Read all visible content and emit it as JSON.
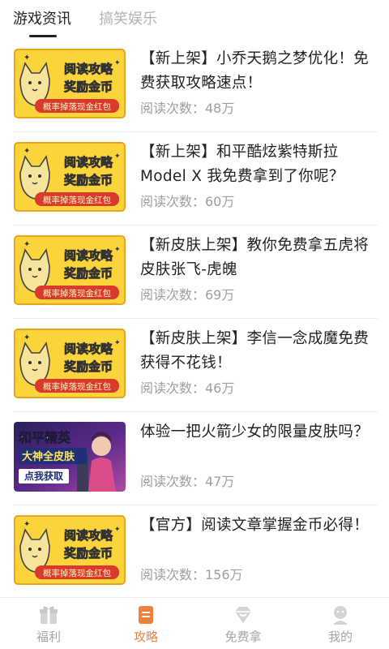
{
  "tabs": [
    {
      "label": "游戏资讯",
      "active": true
    },
    {
      "label": "搞笑娱乐",
      "active": false
    }
  ],
  "thumb_text": {
    "line1": "阅读攻略",
    "line2": "奖励金币",
    "banner": "概率掉落现金红包"
  },
  "game_thumb_text": {
    "line1": "和平精英",
    "line2": "大神全皮肤",
    "button": "点我获取"
  },
  "articles": [
    {
      "title": "【新上架】小乔天鹅之梦优化！免费获取攻略速点！",
      "reads": "阅读次数：48万"
    },
    {
      "title": "【新上架】和平酷炫紫特斯拉Model X 我免费拿到了你呢？",
      "reads": "阅读次数：60万"
    },
    {
      "title": "【新皮肤上架】教你免费拿五虎将皮肤张飞-虎魄",
      "reads": "阅读次数：69万"
    },
    {
      "title": "【新皮肤上架】李信一念成魔免费获得不花钱！",
      "reads": "阅读次数：46万"
    },
    {
      "title": "体验一把火箭少女的限量皮肤吗？",
      "reads": "阅读次数：47万"
    },
    {
      "title": "【官方】阅读文章掌握金币必得！",
      "reads": "阅读次数：156万"
    }
  ],
  "bottom_nav": [
    {
      "label": "福利",
      "icon": "gift-icon",
      "active": false
    },
    {
      "label": "攻略",
      "icon": "guide-icon",
      "active": true
    },
    {
      "label": "免费拿",
      "icon": "diamond-icon",
      "active": false
    },
    {
      "label": "我的",
      "icon": "profile-icon",
      "active": false
    }
  ],
  "colors": {
    "accent": "#f0813a",
    "thumb_yellow": "#fbd33a",
    "thumb_border": "#e9a41a",
    "banner_red": "#d93a2b",
    "text_dark": "#222222",
    "text_gray": "#9e9e9e"
  }
}
